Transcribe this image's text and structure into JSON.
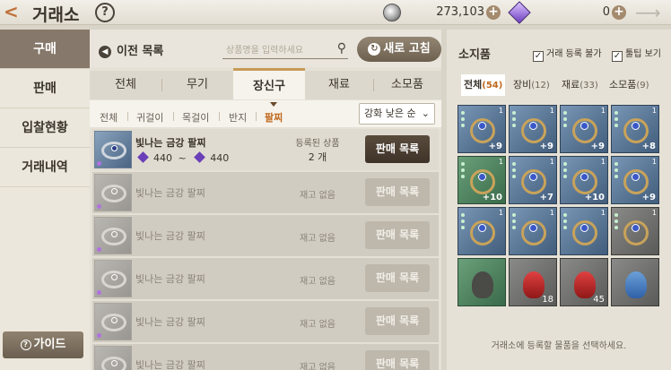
{
  "header": {
    "title": "거래소",
    "help": "?",
    "silver_amount": "273,103",
    "gem_amount": "0",
    "plus": "+"
  },
  "nav": {
    "items": [
      {
        "label": "구매",
        "active": true
      },
      {
        "label": "판매",
        "active": false
      },
      {
        "label": "입찰현황",
        "active": false
      },
      {
        "label": "거래내역",
        "active": false
      }
    ],
    "guide_label": "가이드"
  },
  "main": {
    "prev_label": "이전 목록",
    "search_placeholder": "상품명을 입력하세요",
    "refresh_label": "새로 고침",
    "tabs": [
      "전체",
      "무기",
      "장신구",
      "재료",
      "소모품"
    ],
    "active_tab": "장신구",
    "subtabs": [
      "전체",
      "귀걸이",
      "목걸이",
      "반지",
      "팔찌"
    ],
    "active_subtab": "팔찌",
    "sort_label": "강화 낮은 순",
    "rows": [
      {
        "name": "빛나는 금강 팔찌",
        "price_min": "440",
        "price_sep": "~",
        "price_max": "440",
        "status": "등록된 상품",
        "count": "2 개",
        "button": "판매 목록",
        "available": true
      },
      {
        "name": "빛나는 금강 팔찌",
        "status": "재고 없음",
        "button": "판매 목록",
        "available": false
      },
      {
        "name": "빛나는 금강 팔찌",
        "status": "재고 없음",
        "button": "판매 목록",
        "available": false
      },
      {
        "name": "빛나는 금강 팔찌",
        "status": "재고 없음",
        "button": "판매 목록",
        "available": false
      },
      {
        "name": "빛나는 금강 팔찌",
        "status": "재고 없음",
        "button": "판매 목록",
        "available": false
      },
      {
        "name": "빛나는 금강 팔찌",
        "status": "재고 없음",
        "button": "판매 목록",
        "available": false
      }
    ]
  },
  "inventory": {
    "title": "소지품",
    "check_unregistrable": "거래 등록 불가",
    "check_tooltip": "툴팁 보기",
    "tabs": [
      {
        "label": "전체",
        "count": "(54)"
      },
      {
        "label": "장비",
        "count": "(12)"
      },
      {
        "label": "재료",
        "count": "(33)"
      },
      {
        "label": "소모품",
        "count": "(9)"
      }
    ],
    "cells": [
      {
        "kind": "blue",
        "level": "1",
        "enh": "+9"
      },
      {
        "kind": "blue",
        "level": "1",
        "enh": "+9"
      },
      {
        "kind": "blue",
        "level": "1",
        "enh": "+9"
      },
      {
        "kind": "blue",
        "level": "1",
        "enh": "+8"
      },
      {
        "kind": "green",
        "level": "1",
        "enh": "+10"
      },
      {
        "kind": "blue",
        "level": "1",
        "enh": "+7"
      },
      {
        "kind": "blue",
        "level": "1",
        "enh": "+10"
      },
      {
        "kind": "blue",
        "level": "1",
        "enh": "+9"
      },
      {
        "kind": "blue",
        "level": "1",
        "enh": ""
      },
      {
        "kind": "blue",
        "level": "1",
        "enh": ""
      },
      {
        "kind": "blue",
        "level": "1",
        "enh": ""
      },
      {
        "kind": "gray",
        "level": "1",
        "enh": ""
      },
      {
        "kind": "green",
        "level": "",
        "enh": "",
        "qty": ""
      },
      {
        "kind": "gray",
        "level": "",
        "enh": "",
        "qty": "18"
      },
      {
        "kind": "gray",
        "level": "",
        "enh": "",
        "qty": "45"
      },
      {
        "kind": "gray",
        "level": "",
        "enh": "",
        "qty": ""
      }
    ],
    "hint": "거래소에 등록할 물품을 선택하세요."
  },
  "colors": {
    "accent": "#c0691e",
    "nav_active": "#86786a",
    "button_dark": "#4a3d30"
  }
}
